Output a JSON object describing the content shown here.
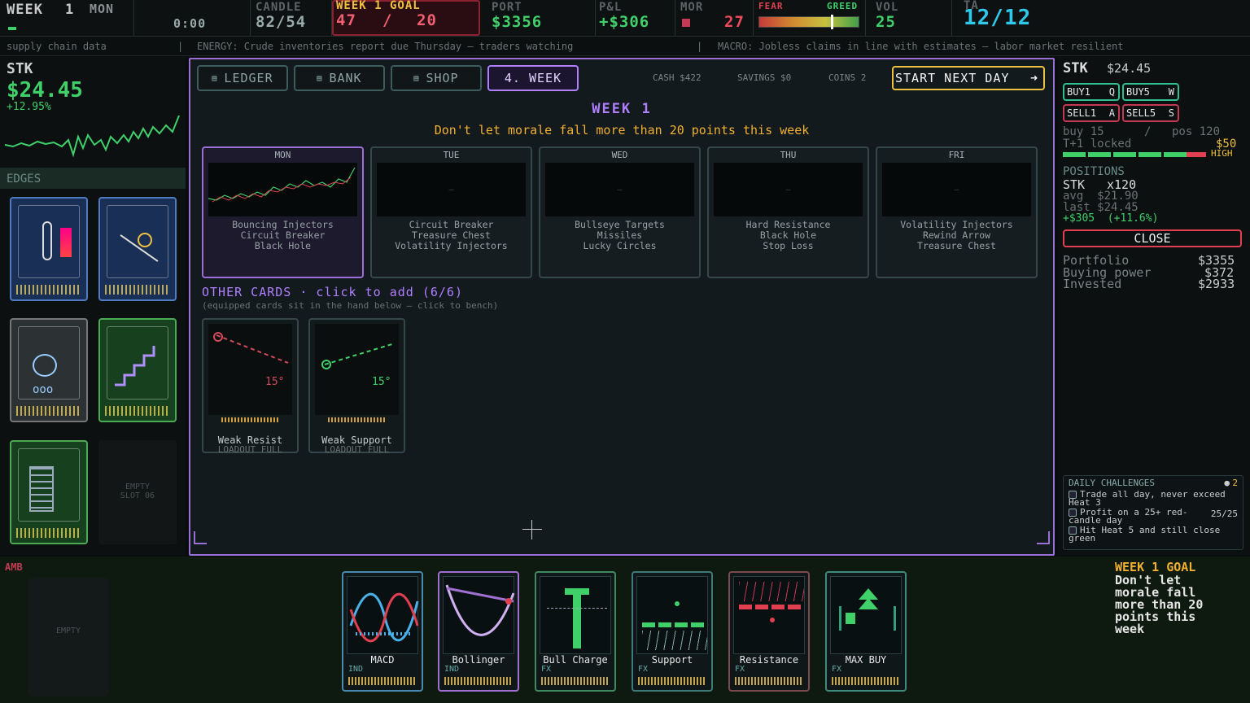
{
  "topbar": {
    "week_label": "WEEK",
    "week_num": "1",
    "day": "MON",
    "clock": "0:00",
    "candle_label": "CANDLE",
    "candle_value": "82/54",
    "goal_label": "WEEK 1 GOAL",
    "goal_current": "47",
    "goal_sep": "/",
    "goal_target": "20",
    "port_label": "PORT",
    "port_value": "$3356",
    "pnl_label": "P&L",
    "pnl_value": "+$306",
    "mor_label": "MOR",
    "mor_value": "27",
    "fear_label": "FEAR",
    "greed_label": "GREED",
    "vol_label": "VOL",
    "vol_value": "25",
    "ta_label": "TA",
    "ta_value": "12/12"
  },
  "ticker": {
    "item1": "supply chain data",
    "sep1": "|",
    "item2": "ENERGY: Crude inventories report due Thursday — traders watching",
    "sep2": "|",
    "item3": "MACRO: Jobless claims in line with estimates — labor market resilient"
  },
  "left": {
    "symbol": "STK",
    "price": "$24.45",
    "change": "+12.95%",
    "edges_label": "EDGES",
    "empty_slot_line1": "EMPTY",
    "empty_slot_line2": "SLOT 06"
  },
  "modal": {
    "tabs": [
      {
        "label": "LEDGER"
      },
      {
        "label": "BANK"
      },
      {
        "label": "SHOP"
      },
      {
        "label": "4. WEEK"
      }
    ],
    "cash": "CASH $422",
    "savings": "SAVINGS $0",
    "coins": "COINS 2",
    "start_button": "START NEXT DAY",
    "week_title": "WEEK 1",
    "goal_text": "Don't let morale fall more than 20 points this week",
    "days": [
      {
        "name": "MON",
        "cards": [
          "Bouncing Injectors",
          "Circuit Breaker",
          "Black Hole"
        ]
      },
      {
        "name": "TUE",
        "cards": [
          "Circuit Breaker",
          "Treasure Chest",
          "Volatility Injectors"
        ]
      },
      {
        "name": "WED",
        "cards": [
          "Bullseye Targets",
          "Missiles",
          "Lucky Circles"
        ]
      },
      {
        "name": "THU",
        "cards": [
          "Hard Resistance",
          "Black Hole",
          "Stop Loss"
        ]
      },
      {
        "name": "FRI",
        "cards": [
          "Volatility Injectors",
          "Rewind Arrow",
          "Treasure Chest"
        ]
      }
    ],
    "dash": "—",
    "other_title": "OTHER CARDS · click to add (6/6)",
    "other_sub": "(equipped cards sit in the hand below — click to bench)",
    "other_cards": [
      {
        "name": "Weak Resist",
        "status": "LOADOUT FULL",
        "angle": "15°"
      },
      {
        "name": "Weak Support",
        "status": "LOADOUT FULL",
        "angle": "15°"
      }
    ]
  },
  "right": {
    "symbol": "STK",
    "price": "$24.45",
    "buy1": "BUY1",
    "buy1_key": "Q",
    "buy5": "BUY5",
    "buy5_key": "W",
    "sell1": "SELL1",
    "sell1_key": "A",
    "sell5": "SELL5",
    "sell5_key": "S",
    "buy_info": "buy 15",
    "buy_sep": "/",
    "pos_info": "pos 120",
    "locked": "T+1 locked",
    "locked_val": "$50",
    "heat": "HIGH",
    "positions_label": "POSITIONS",
    "pos_sym": "STK",
    "pos_qty": "x120",
    "avg": "avg  $21.90",
    "last": "last $24.45",
    "pnl": "+$305  (+11.6%)",
    "close": "CLOSE",
    "portfolio_label": "Portfolio",
    "portfolio_val": "$3355",
    "buying_label": "Buying power",
    "buying_val": "$372",
    "invested_label": "Invested",
    "invested_val": "$2933",
    "challenges_label": "DAILY CHALLENGES",
    "challenges_count": "2",
    "challenges": [
      {
        "text": "Trade all day, never exceed Heat 3",
        "progress": ""
      },
      {
        "text": "Profit on a 25+ red-candle day",
        "progress": "25/25"
      },
      {
        "text": "Hit Heat 5 and still close green",
        "progress": ""
      }
    ]
  },
  "bottom": {
    "amb": "AMB",
    "empty": "EMPTY",
    "goal_title": "WEEK 1 GOAL",
    "goal_text": "Don't let morale fall more than 20 points this week",
    "hand": [
      {
        "name": "MACD",
        "type": "IND",
        "color": "#4ab0c8"
      },
      {
        "name": "Bollinger",
        "type": "IND",
        "color": "#a070d0"
      },
      {
        "name": "Bull Charge",
        "type": "FX",
        "color": "#3fd06a"
      },
      {
        "name": "Support",
        "type": "FX",
        "color": "#3fd06a"
      },
      {
        "name": "Resistance",
        "type": "FX",
        "color": "#d04a5a"
      },
      {
        "name": "MAX BUY",
        "type": "FX",
        "color": "#3fd06a"
      }
    ]
  },
  "colors": {
    "accent_purple": "#9a6fd6",
    "gold": "#f0c040",
    "green": "#3fd06a",
    "red": "#e04050",
    "cyan": "#2fc8c8"
  }
}
